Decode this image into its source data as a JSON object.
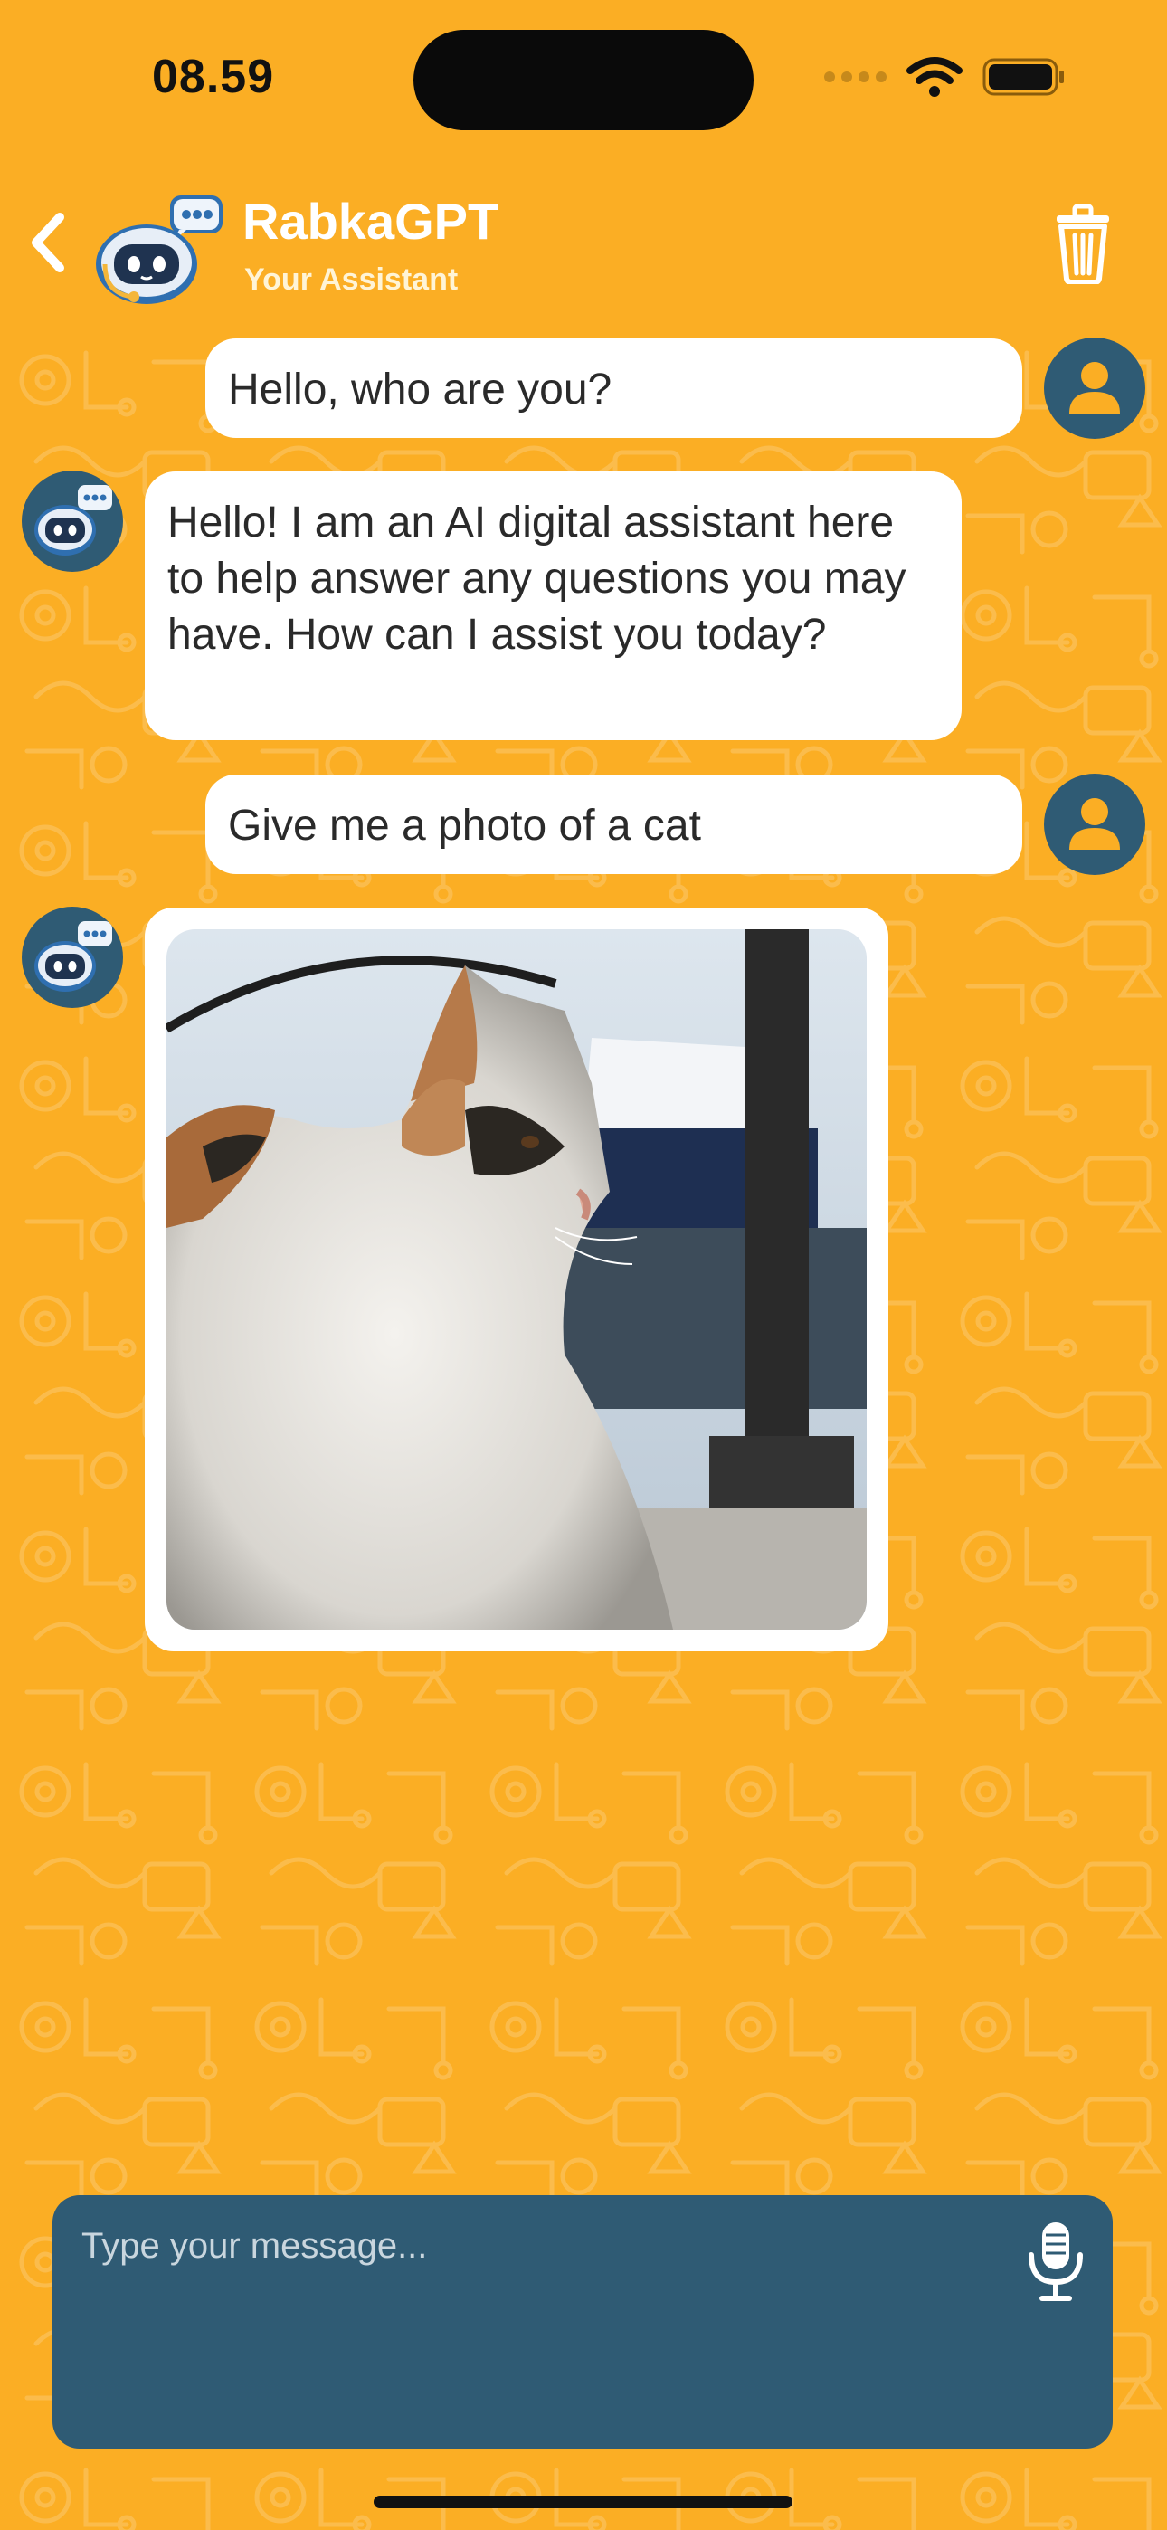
{
  "status_bar": {
    "time": "08.59"
  },
  "header": {
    "title": "RabkaGPT",
    "subtitle": "Your Assistant",
    "back_icon": "chevron-left-icon",
    "delete_icon": "trash-icon"
  },
  "messages": [
    {
      "sender": "user",
      "text": "Hello, who are you?"
    },
    {
      "sender": "bot",
      "text": "Hello! I am an AI digital assistant here to help answer any questions you may have. How can I assist you today?"
    },
    {
      "sender": "user",
      "text": "Give me a photo of a cat"
    },
    {
      "sender": "bot",
      "type": "image",
      "image": "calico-cat-photo"
    }
  ],
  "composer": {
    "placeholder": "Type your message...",
    "mic_icon": "microphone-icon"
  },
  "colors": {
    "background": "#FBAE24",
    "accent": "#2F5B74",
    "bubble": "#FFFFFF"
  }
}
